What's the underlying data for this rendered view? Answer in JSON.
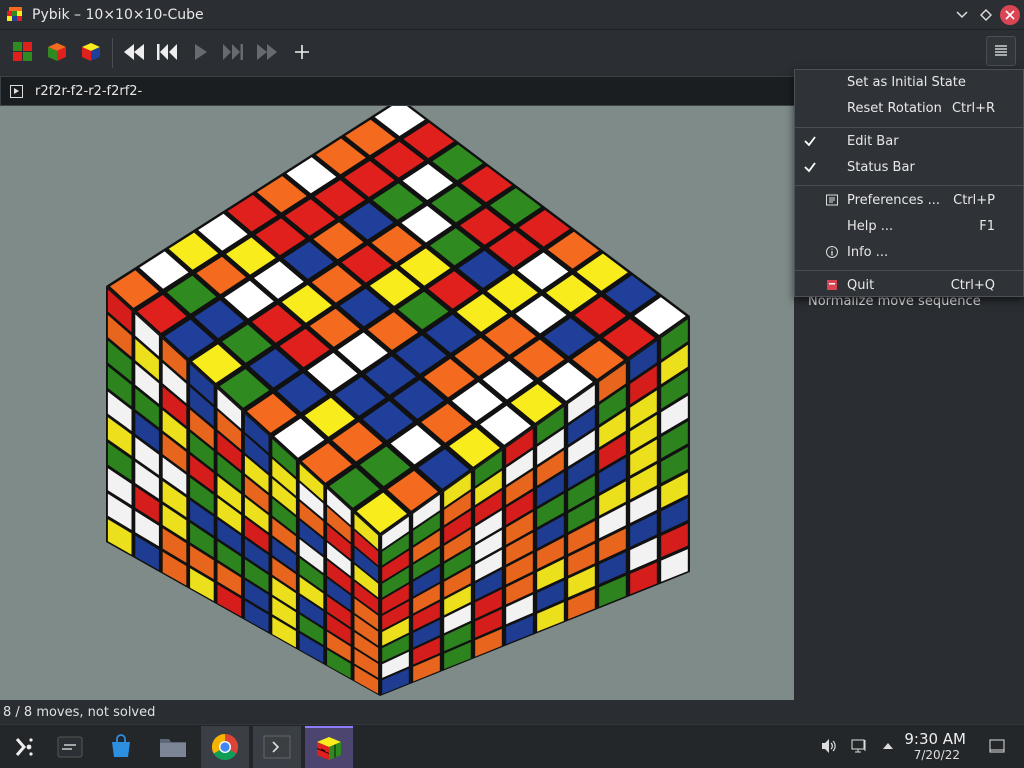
{
  "window": {
    "title": "Pybik – 10×10×10-Cube"
  },
  "edit_bar": {
    "move_sequence": "r2f2r-f2-r2-f2rf2-"
  },
  "menu": {
    "items": [
      {
        "label": "Set as Initial State",
        "shortcut": ""
      },
      {
        "label": "Reset Rotation",
        "shortcut": "Ctrl+R"
      },
      {
        "label": "Edit Bar",
        "shortcut": "",
        "checked": true
      },
      {
        "label": "Status Bar",
        "shortcut": "",
        "checked": true
      },
      {
        "label": "Preferences ...",
        "shortcut": "Ctrl+P",
        "icon": "preferences-icon"
      },
      {
        "label": "Help ...",
        "shortcut": "F1"
      },
      {
        "label": "Info ...",
        "shortcut": "",
        "icon": "info-icon"
      },
      {
        "label": "Quit",
        "shortcut": "Ctrl+Q",
        "icon": "quit-icon"
      }
    ]
  },
  "side_panel": {
    "normalize_label": "Normalize move sequence"
  },
  "status": {
    "text": "8 / 8 moves, not solved"
  },
  "clock": {
    "time": "9:30 AM",
    "date": "7/20/22"
  },
  "colors": {
    "red": "#e0201c",
    "green": "#2f8a1f",
    "blue": "#1f3f9a",
    "yellow": "#f8ec1c",
    "white": "#ffffff",
    "orange": "#f46a1f",
    "background": "#7e8b88"
  }
}
